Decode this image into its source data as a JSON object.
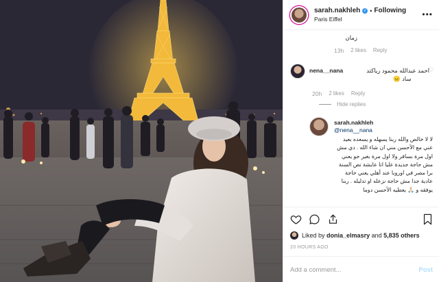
{
  "post": {
    "username": "sarah.nakhleh",
    "follow_label": "Following",
    "location": "Paris Eiffel"
  },
  "comments": {
    "partial_prev_text": "زمان",
    "partial_prev_time": "13h",
    "partial_prev_likes": "2 likes",
    "partial_prev_reply": "Reply",
    "c1_user": "nena__nana",
    "c1_text_1": "احمد عبدالله محمود رياكتد",
    "c1_text_2": "ساد 😑",
    "c1_time": "20h",
    "c1_likes": "2 likes",
    "c1_reply": "Reply",
    "hide_replies": "Hide replies",
    "reply_user": "sarah.nakhleh",
    "reply_mention": "@nena__nana",
    "reply_text": "لا لا خالص والله ربنا يسهله و يسعده بعيد عني مع الأحسن مني ان شاء الله . دي مش اول مرة بسافر ولا اول مرة بغير جو يعني مش حاجة جديدة عليا انا عايشة نص السنة برا مصر في اوروبا عند أهلي يعني حاجة عادية جدا مش حاجة نزعله او تدليله . ربنا يوفقه و 🙏🏻 يعطيه الأحسن دوما"
  },
  "actions": {
    "liked_by_prefix": "Liked by",
    "liked_by_user": "donia_elmasry",
    "liked_by_and": "and",
    "liked_by_count": "5,835 others",
    "time_ago": "20 HOURS AGO",
    "comment_placeholder": "Add a comment...",
    "post_label": "Post"
  },
  "colors": {
    "link_blue": "#003569",
    "verified_blue": "#3897f0",
    "post_disabled": "#b2dffc",
    "meta_gray": "#999999"
  },
  "icons": [
    "more-icon",
    "heart-icon",
    "comment-icon",
    "share-icon",
    "bookmark-icon",
    "verified-icon"
  ]
}
